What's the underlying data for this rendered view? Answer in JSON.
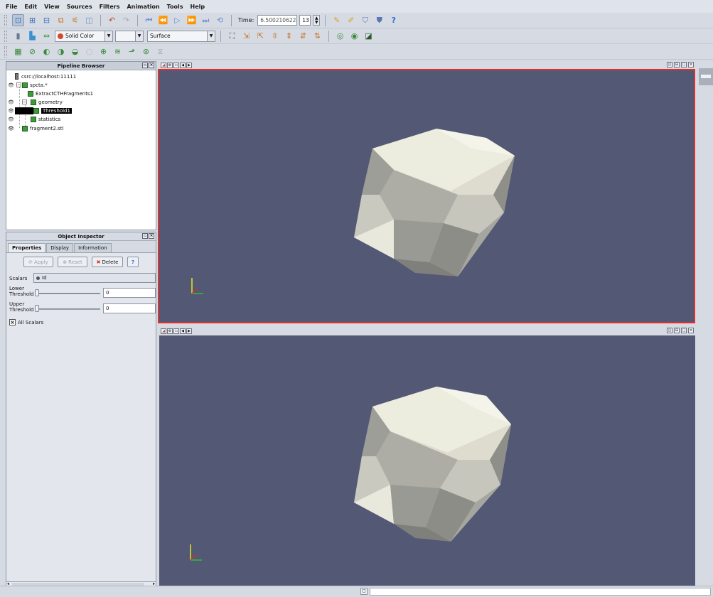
{
  "menu": [
    "File",
    "Edit",
    "View",
    "Sources",
    "Filters",
    "Animation",
    "Tools",
    "Help"
  ],
  "toolbar1": {
    "time_label": "Time:",
    "time_value": "6.5002106224052",
    "frame_value": "13"
  },
  "toolbar2": {
    "color_combo": "Solid Color",
    "component_combo": "",
    "representation_combo": "Surface"
  },
  "pipeline": {
    "title": "Pipeline Browser",
    "items": [
      {
        "label": "csrc://localhost:11111"
      },
      {
        "label": "spcta.*"
      },
      {
        "label": "ExtractCTHFragments1"
      },
      {
        "label": "geometry"
      },
      {
        "label": "Threshold1"
      },
      {
        "label": "statistics"
      },
      {
        "label": "fragment2.stl"
      }
    ]
  },
  "inspector": {
    "title": "Object Inspector",
    "tabs": [
      "Properties",
      "Display",
      "Information"
    ],
    "apply_label": "Apply",
    "reset_label": "Reset",
    "delete_label": "Delete",
    "help_label": "?",
    "scalars_label": "Scalars",
    "scalars_value": "Id",
    "lower_label_1": "Lower",
    "lower_label_2": "Threshold",
    "lower_value": "0",
    "upper_label_1": "Upper",
    "upper_label_2": "Threshold",
    "upper_value": "0",
    "all_scalars_label": "All Scalars"
  },
  "colors": {
    "viewport_bg": "#535874",
    "active_border": "#e0302e",
    "selection": "#000000"
  }
}
